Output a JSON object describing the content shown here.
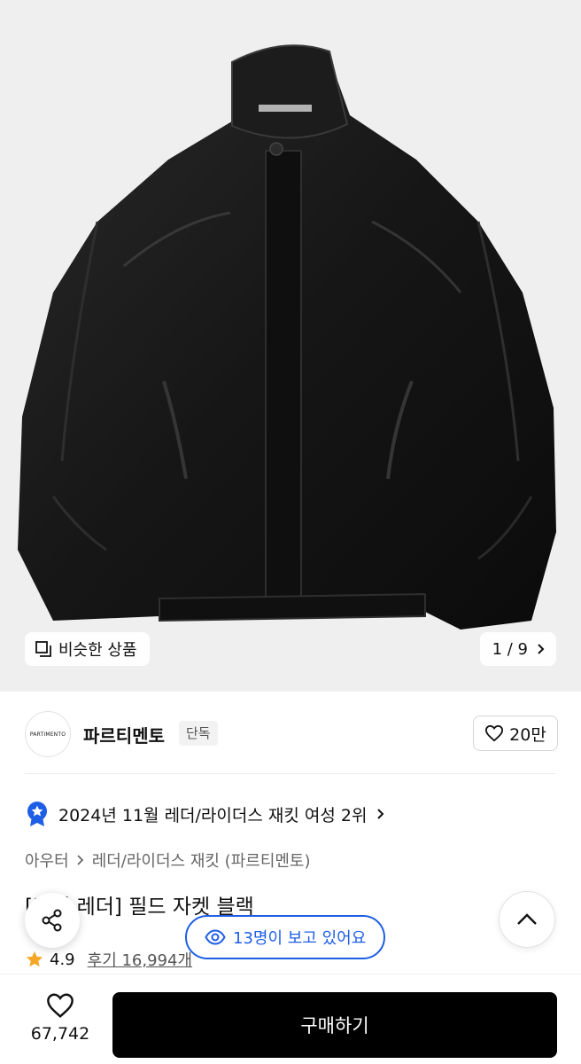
{
  "gallery": {
    "similar_label": "비슷한 상품",
    "page_indicator": "1 / 9",
    "icons": {
      "similar": "similar-products-icon",
      "next": "chevron-right-icon"
    }
  },
  "brand": {
    "logo_text": "PARTIMENTO",
    "name": "파르티멘토",
    "tag": "단독",
    "likes": "20만"
  },
  "ranking": {
    "text": "2024년 11월 레더/라이더스 재킷 여성 2위",
    "icon": "ranking-badge-icon"
  },
  "breadcrumb": {
    "items": [
      "아우터",
      "레더/라이더스 재킷 (파르티멘토)"
    ]
  },
  "product": {
    "title": "[비건 레더] 필드 자켓 블랙",
    "rating": "4.9",
    "reviews": "후기 16,994개"
  },
  "viewers": {
    "text": "13명이 보고 있어요",
    "icon": "eye-icon"
  },
  "bottom_bar": {
    "wish_count": "67,742",
    "buy_label": "구매하기"
  },
  "colors": {
    "accent_blue": "#1e5ee6",
    "buy_button": "#000000",
    "star": "#f5a623"
  }
}
